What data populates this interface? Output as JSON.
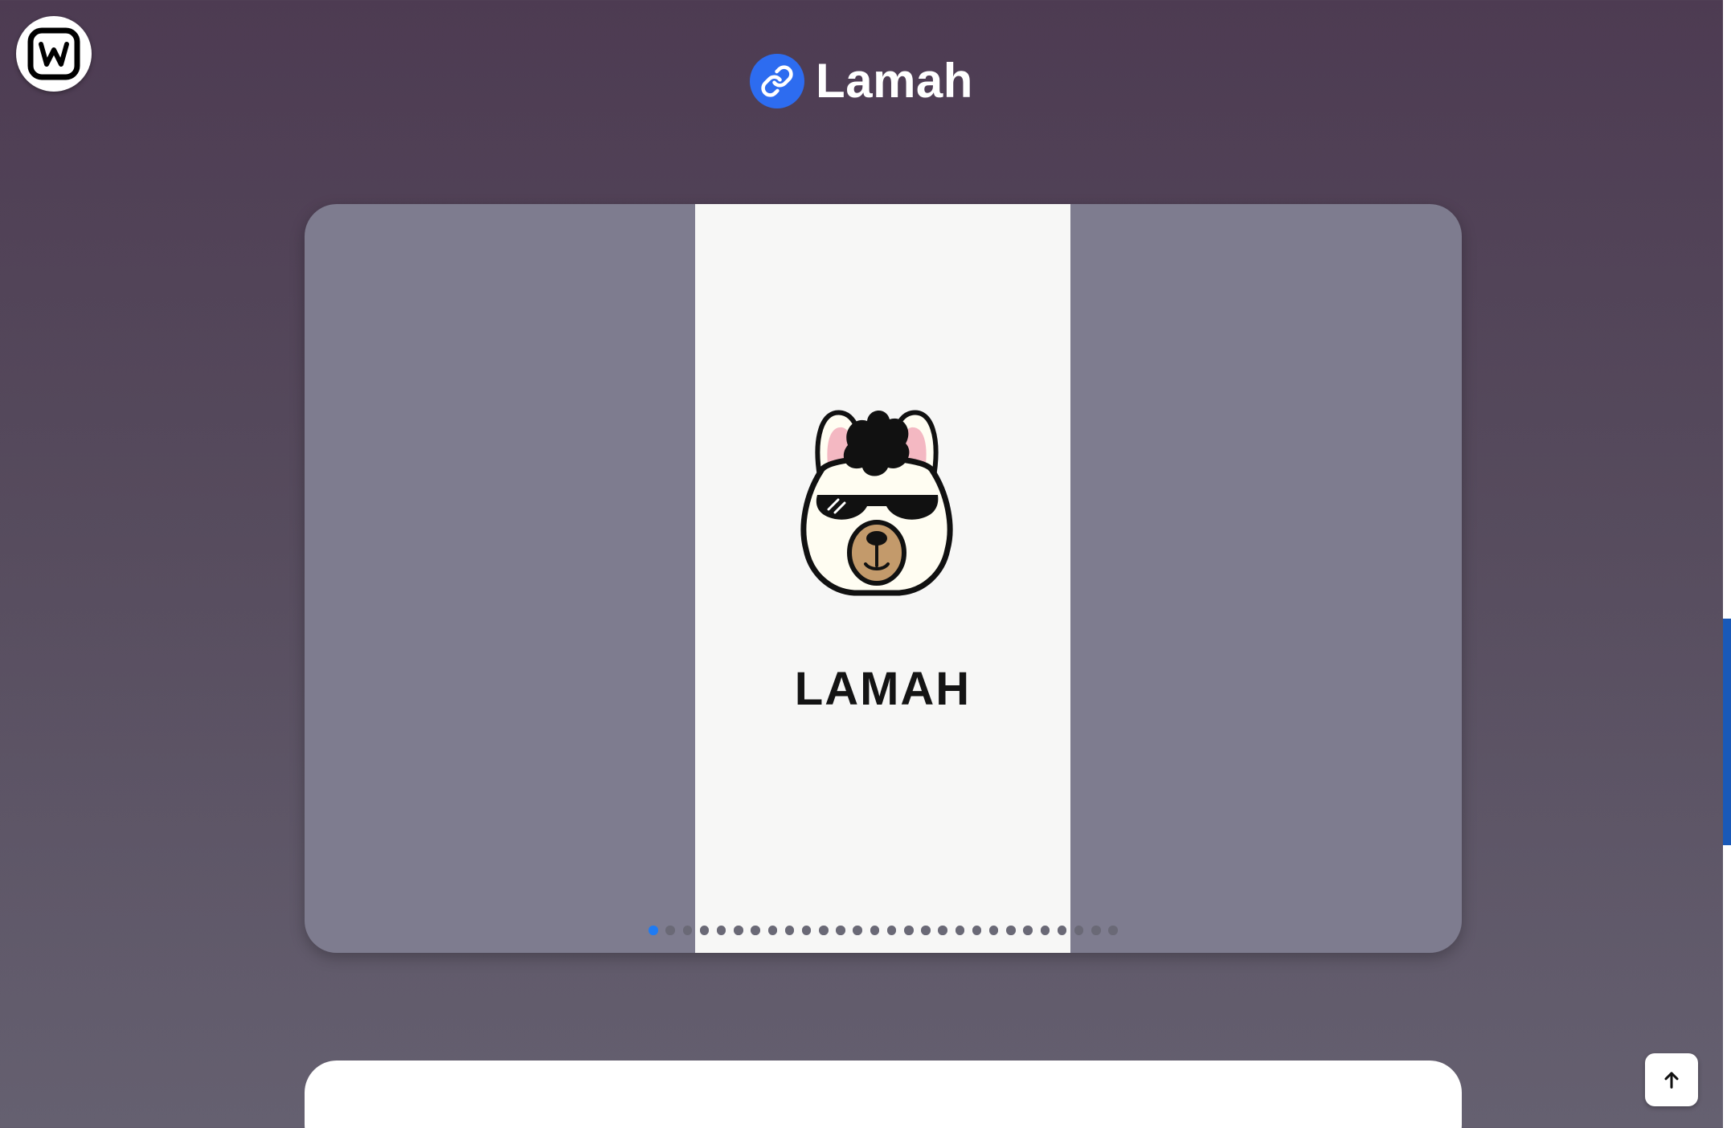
{
  "app": {
    "title": "Lamah",
    "icons": {
      "site_badge": "w-logo-icon",
      "header": "link-icon",
      "scroll_top": "arrow-up-icon"
    },
    "colors": {
      "accent": "#2d6cf0",
      "active_dot": "#1f7bf2"
    }
  },
  "carousel": {
    "slide_brand": "LAMAH",
    "slide_count": 28,
    "active_index": 0
  }
}
